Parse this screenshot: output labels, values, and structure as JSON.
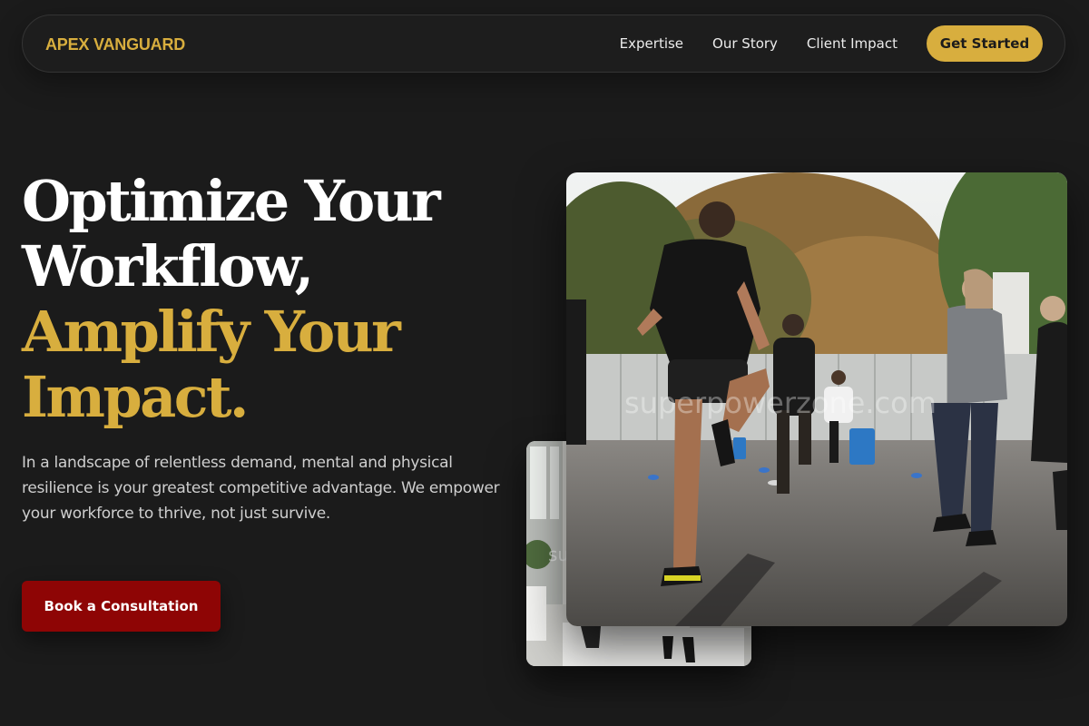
{
  "nav": {
    "brand": "APEX VANGUARD",
    "links": [
      "Expertise",
      "Our Story",
      "Client Impact"
    ],
    "cta_label": "Get Started"
  },
  "hero": {
    "headline_line1": "Optimize Your",
    "headline_line2": "Workflow,",
    "headline_line3": "Amplify Your",
    "headline_line4": "Impact.",
    "lead": "In a landscape of relentless demand, mental and physical resilience is your greatest competitive advantage. We empower your workforce to thrive, not just survive.",
    "cta_label": "Book a Consultation"
  },
  "images": {
    "main_watermark": "superpowerzone.com",
    "back_watermark": "su"
  },
  "colors": {
    "background": "#1b1b1b",
    "accent_gold": "#d8ae3e",
    "cta_red": "#8e0505",
    "text_light": "#cfcfcf"
  }
}
